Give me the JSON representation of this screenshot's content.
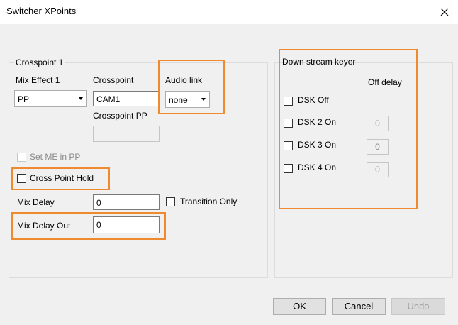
{
  "window": {
    "title": "Switcher XPoints",
    "close_glyph": "✕"
  },
  "crosspoint": {
    "group_title": "Crosspoint 1",
    "mix_effect_label": "Mix Effect 1",
    "mix_effect_value": "PP",
    "crosspoint_label": "Crosspoint",
    "crosspoint_value": "CAM1",
    "crosspoint_pp_label": "Crosspoint PP",
    "crosspoint_pp_value": "",
    "audio_link_label": "Audio link",
    "audio_link_value": "none",
    "set_me_in_pp_label": "Set ME in PP",
    "cross_point_hold_label": "Cross Point Hold",
    "mix_delay_label": "Mix Delay",
    "mix_delay_value": "0",
    "transition_only_label": "Transition Only",
    "mix_delay_out_label": "Mix Delay Out",
    "mix_delay_out_value": "0"
  },
  "dsk": {
    "group_title": "Down stream keyer",
    "off_delay_label": "Off delay",
    "items": [
      {
        "label": "DSK Off"
      },
      {
        "label": "DSK 2 On",
        "delay": "0"
      },
      {
        "label": "DSK 3 On",
        "delay": "0"
      },
      {
        "label": "DSK 4 On",
        "delay": "0"
      }
    ]
  },
  "buttons": {
    "ok": "OK",
    "cancel": "Cancel",
    "undo": "Undo"
  },
  "colors": {
    "highlight": "#f08a2f"
  }
}
